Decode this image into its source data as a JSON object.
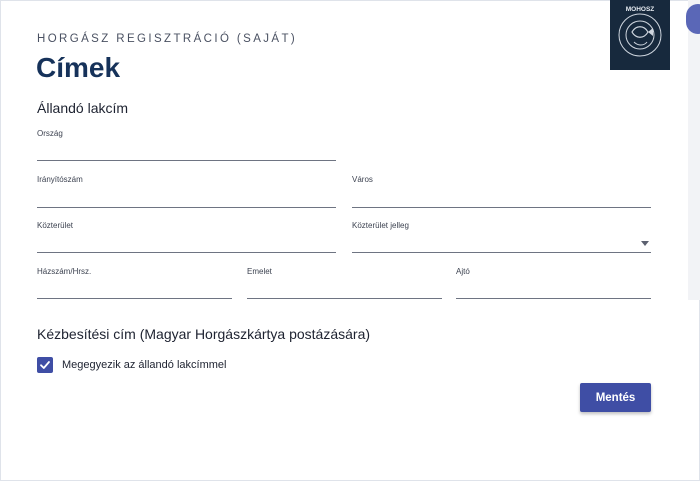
{
  "header": {
    "supertitle": "HORGÁSZ REGISZTRÁCIÓ (SAJÁT)",
    "title": "Címek"
  },
  "logo": {
    "text": "MOHOSZ",
    "icon": "mohosz-logo-icon"
  },
  "permanent_address": {
    "section_title": "Állandó lakcím",
    "country_label": "Ország",
    "country_value": "",
    "zip_label": "Irányítószám",
    "zip_value": "",
    "city_label": "Város",
    "city_value": "",
    "street_label": "Közterület",
    "street_value": "",
    "street_type_label": "Közterület jelleg",
    "street_type_value": "",
    "house_number_label": "Házszám/Hrsz.",
    "house_number_value": "",
    "floor_label": "Emelet",
    "floor_value": "",
    "door_label": "Ajtó",
    "door_value": ""
  },
  "delivery_address": {
    "section_title": "Kézbesítési cím (Magyar Horgászkártya postázására)",
    "same_as_permanent_label": "Megegyezik az állandó lakcímmel",
    "same_as_permanent_checked": true
  },
  "actions": {
    "save_label": "Mentés"
  },
  "colors": {
    "primary": "#3f4ea5",
    "title": "#16325a",
    "logo_bg": "#17293d"
  }
}
